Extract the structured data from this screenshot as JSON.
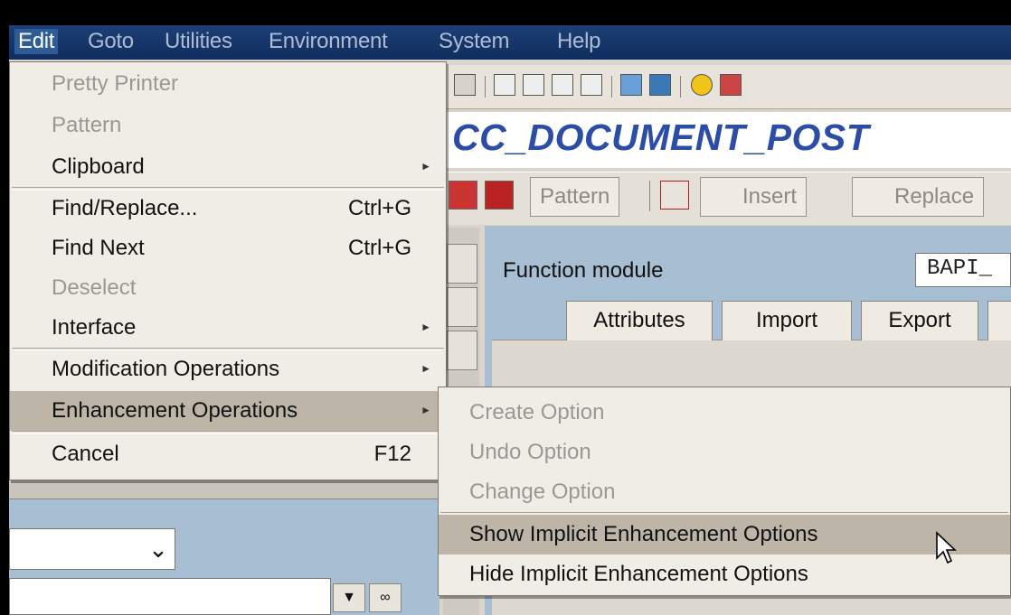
{
  "menubar": {
    "items": [
      "Edit",
      "Goto",
      "Utilities",
      "Environment",
      "System",
      "Help"
    ],
    "active": "Edit"
  },
  "edit_menu": {
    "items": [
      {
        "label": "Pretty Printer",
        "shortcut": "",
        "submenu": false,
        "enabled": false
      },
      {
        "label": "Pattern",
        "shortcut": "",
        "submenu": false,
        "enabled": false
      },
      {
        "label": "Clipboard",
        "shortcut": "",
        "submenu": true,
        "enabled": true
      },
      {
        "label": "Find/Replace...",
        "shortcut": "Ctrl+G",
        "submenu": false,
        "enabled": true
      },
      {
        "label": "Find Next",
        "shortcut": "Ctrl+G",
        "submenu": false,
        "enabled": true
      },
      {
        "label": "Deselect",
        "shortcut": "",
        "submenu": false,
        "enabled": false
      },
      {
        "label": "Interface",
        "shortcut": "",
        "submenu": true,
        "enabled": true
      },
      {
        "label": "Modification Operations",
        "shortcut": "",
        "submenu": true,
        "enabled": true
      },
      {
        "label": "Enhancement Operations",
        "shortcut": "",
        "submenu": true,
        "enabled": true,
        "highlighted": true
      },
      {
        "label": "Cancel",
        "shortcut": "F12",
        "submenu": false,
        "enabled": true
      }
    ]
  },
  "enhancement_submenu": {
    "items": [
      {
        "label": "Create Option",
        "enabled": false
      },
      {
        "label": "Undo Option",
        "enabled": false
      },
      {
        "label": "Change Option",
        "enabled": false
      },
      {
        "label": "Show Implicit Enhancement Options",
        "enabled": true,
        "highlighted": true
      },
      {
        "label": "Hide Implicit Enhancement Options",
        "enabled": true
      }
    ]
  },
  "screen": {
    "title": "CC_DOCUMENT_POST",
    "function_module_label": "Function module",
    "function_module_value": "BAPI_",
    "tabs": [
      "Attributes",
      "Import",
      "Export"
    ]
  },
  "app_toolbar": {
    "pattern": "Pattern",
    "insert": "Insert",
    "replace": "Replace"
  },
  "colors": {
    "menubar": "#0f2d5e",
    "title": "#2b4da6",
    "highlight": "#bdb6a8",
    "work_area": "#a8bed3"
  }
}
